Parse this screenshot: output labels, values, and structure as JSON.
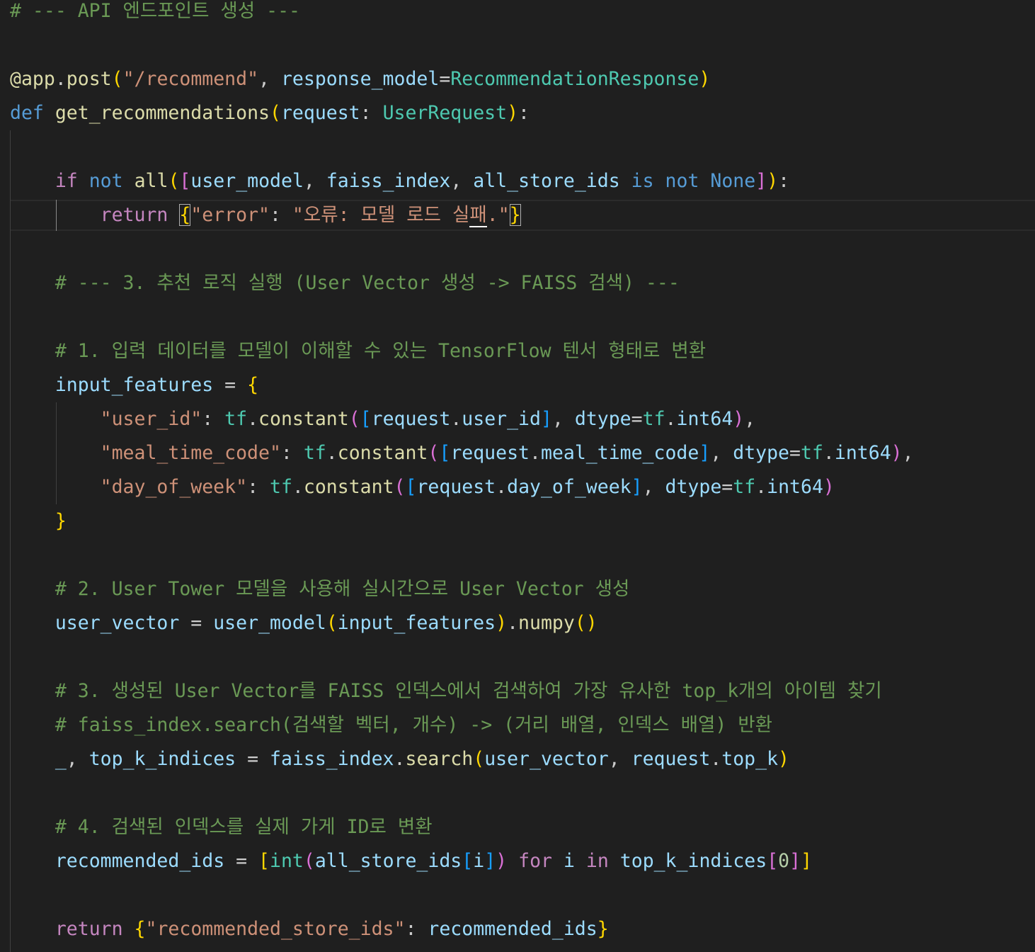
{
  "editor": {
    "language": "python",
    "colors": {
      "background": "#1f1f1f",
      "comment": "#6a9955",
      "string": "#ce9178",
      "keyword": "#569cd6",
      "control": "#c586c0",
      "function": "#dcdcaa",
      "variable": "#9cdcfe",
      "class": "#4ec9b0",
      "bracket_level_1": "#ffd700",
      "bracket_level_2": "#da70d6",
      "bracket_level_3": "#179fff"
    },
    "lines": [
      [
        [
          "# --- API 엔드포인트 생성 ---",
          "cmt"
        ]
      ],
      [],
      [
        [
          "@app",
          "fn"
        ],
        [
          ".",
          "pun"
        ],
        [
          "post",
          "fn"
        ],
        [
          "(",
          "b1"
        ],
        [
          "\"/recommend\"",
          "str"
        ],
        [
          ", ",
          "pun"
        ],
        [
          "response_model",
          "var"
        ],
        [
          "=",
          "pun"
        ],
        [
          "RecommendationResponse",
          "cls"
        ],
        [
          ")",
          "b1"
        ]
      ],
      [
        [
          "def",
          "kw"
        ],
        [
          " ",
          "pun"
        ],
        [
          "get_recommendations",
          "fn"
        ],
        [
          "(",
          "b1"
        ],
        [
          "request",
          "var"
        ],
        [
          ": ",
          "pun"
        ],
        [
          "UserRequest",
          "cls"
        ],
        [
          ")",
          "b1"
        ],
        [
          ":",
          "pun"
        ]
      ],
      [],
      [
        [
          "    ",
          "pun"
        ],
        [
          "if",
          "ctl"
        ],
        [
          " ",
          "pun"
        ],
        [
          "not",
          "kw"
        ],
        [
          " ",
          "pun"
        ],
        [
          "all",
          "fn"
        ],
        [
          "(",
          "b1"
        ],
        [
          "[",
          "b2"
        ],
        [
          "user_model",
          "var"
        ],
        [
          ", ",
          "pun"
        ],
        [
          "faiss_index",
          "var"
        ],
        [
          ", ",
          "pun"
        ],
        [
          "all_store_ids",
          "var"
        ],
        [
          " ",
          "pun"
        ],
        [
          "is",
          "kw"
        ],
        [
          " ",
          "pun"
        ],
        [
          "not",
          "kw"
        ],
        [
          " ",
          "pun"
        ],
        [
          "None",
          "kw"
        ],
        [
          "]",
          "b2"
        ],
        [
          ")",
          "b1"
        ],
        [
          ":",
          "pun"
        ]
      ],
      [
        [
          "        ",
          "pun"
        ],
        [
          "return",
          "ctl"
        ],
        [
          " ",
          "pun"
        ],
        [
          "{",
          "b1",
          "bm"
        ],
        [
          "\"error\"",
          "str"
        ],
        [
          ": ",
          "pun"
        ],
        [
          "\"오류: 모델 로드 실",
          "str"
        ],
        [
          "패",
          "str",
          "cursor"
        ],
        [
          ".\"",
          "str"
        ],
        [
          "}",
          "b1",
          "bm"
        ]
      ],
      [],
      [
        [
          "    ",
          "pun"
        ],
        [
          "# --- 3. 추천 로직 실행 (User Vector 생성 -> FAISS 검색) ---",
          "cmt"
        ]
      ],
      [],
      [
        [
          "    ",
          "pun"
        ],
        [
          "# 1. 입력 데이터를 모델이 이해할 수 있는 TensorFlow 텐서 형태로 변환",
          "cmt"
        ]
      ],
      [
        [
          "    ",
          "pun"
        ],
        [
          "input_features",
          "var"
        ],
        [
          " = ",
          "pun"
        ],
        [
          "{",
          "b1"
        ]
      ],
      [
        [
          "        ",
          "pun"
        ],
        [
          "\"user_id\"",
          "str"
        ],
        [
          ": ",
          "pun"
        ],
        [
          "tf",
          "cls"
        ],
        [
          ".",
          "pun"
        ],
        [
          "constant",
          "fn"
        ],
        [
          "(",
          "b2"
        ],
        [
          "[",
          "b3"
        ],
        [
          "request",
          "var"
        ],
        [
          ".",
          "pun"
        ],
        [
          "user_id",
          "var"
        ],
        [
          "]",
          "b3"
        ],
        [
          ", ",
          "pun"
        ],
        [
          "dtype",
          "var"
        ],
        [
          "=",
          "pun"
        ],
        [
          "tf",
          "cls"
        ],
        [
          ".",
          "pun"
        ],
        [
          "int64",
          "var"
        ],
        [
          ")",
          "b2"
        ],
        [
          ",",
          "pun"
        ]
      ],
      [
        [
          "        ",
          "pun"
        ],
        [
          "\"meal_time_code\"",
          "str"
        ],
        [
          ": ",
          "pun"
        ],
        [
          "tf",
          "cls"
        ],
        [
          ".",
          "pun"
        ],
        [
          "constant",
          "fn"
        ],
        [
          "(",
          "b2"
        ],
        [
          "[",
          "b3"
        ],
        [
          "request",
          "var"
        ],
        [
          ".",
          "pun"
        ],
        [
          "meal_time_code",
          "var"
        ],
        [
          "]",
          "b3"
        ],
        [
          ", ",
          "pun"
        ],
        [
          "dtype",
          "var"
        ],
        [
          "=",
          "pun"
        ],
        [
          "tf",
          "cls"
        ],
        [
          ".",
          "pun"
        ],
        [
          "int64",
          "var"
        ],
        [
          ")",
          "b2"
        ],
        [
          ",",
          "pun"
        ]
      ],
      [
        [
          "        ",
          "pun"
        ],
        [
          "\"day_of_week\"",
          "str"
        ],
        [
          ": ",
          "pun"
        ],
        [
          "tf",
          "cls"
        ],
        [
          ".",
          "pun"
        ],
        [
          "constant",
          "fn"
        ],
        [
          "(",
          "b2"
        ],
        [
          "[",
          "b3"
        ],
        [
          "request",
          "var"
        ],
        [
          ".",
          "pun"
        ],
        [
          "day_of_week",
          "var"
        ],
        [
          "]",
          "b3"
        ],
        [
          ", ",
          "pun"
        ],
        [
          "dtype",
          "var"
        ],
        [
          "=",
          "pun"
        ],
        [
          "tf",
          "cls"
        ],
        [
          ".",
          "pun"
        ],
        [
          "int64",
          "var"
        ],
        [
          ")",
          "b2"
        ]
      ],
      [
        [
          "    ",
          "pun"
        ],
        [
          "}",
          "b1"
        ]
      ],
      [],
      [
        [
          "    ",
          "pun"
        ],
        [
          "# 2. User Tower 모델을 사용해 실시간으로 User Vector 생성",
          "cmt"
        ]
      ],
      [
        [
          "    ",
          "pun"
        ],
        [
          "user_vector",
          "var"
        ],
        [
          " = ",
          "pun"
        ],
        [
          "user_model",
          "var"
        ],
        [
          "(",
          "b1"
        ],
        [
          "input_features",
          "var"
        ],
        [
          ")",
          "b1"
        ],
        [
          ".",
          "pun"
        ],
        [
          "numpy",
          "fn"
        ],
        [
          "()",
          "b1"
        ]
      ],
      [],
      [
        [
          "    ",
          "pun"
        ],
        [
          "# 3. 생성된 User Vector를 FAISS 인덱스에서 검색하여 가장 유사한 top_k개의 아이템 찾기",
          "cmt"
        ]
      ],
      [
        [
          "    ",
          "pun"
        ],
        [
          "# faiss_index.search(검색할 벡터, 개수) -> (거리 배열, 인덱스 배열) 반환",
          "cmt"
        ]
      ],
      [
        [
          "    ",
          "pun"
        ],
        [
          "_",
          "var"
        ],
        [
          ", ",
          "pun"
        ],
        [
          "top_k_indices",
          "var"
        ],
        [
          " = ",
          "pun"
        ],
        [
          "faiss_index",
          "var"
        ],
        [
          ".",
          "pun"
        ],
        [
          "search",
          "fn"
        ],
        [
          "(",
          "b1"
        ],
        [
          "user_vector",
          "var"
        ],
        [
          ", ",
          "pun"
        ],
        [
          "request",
          "var"
        ],
        [
          ".",
          "pun"
        ],
        [
          "top_k",
          "var"
        ],
        [
          ")",
          "b1"
        ]
      ],
      [],
      [
        [
          "    ",
          "pun"
        ],
        [
          "# 4. 검색된 인덱스를 실제 가게 ID로 변환",
          "cmt"
        ]
      ],
      [
        [
          "    ",
          "pun"
        ],
        [
          "recommended_ids",
          "var"
        ],
        [
          " = ",
          "pun"
        ],
        [
          "[",
          "b1"
        ],
        [
          "int",
          "cls"
        ],
        [
          "(",
          "b2"
        ],
        [
          "all_store_ids",
          "var"
        ],
        [
          "[",
          "b3"
        ],
        [
          "i",
          "var"
        ],
        [
          "]",
          "b3"
        ],
        [
          ")",
          "b2"
        ],
        [
          " ",
          "pun"
        ],
        [
          "for",
          "ctl"
        ],
        [
          " ",
          "pun"
        ],
        [
          "i",
          "var"
        ],
        [
          " ",
          "pun"
        ],
        [
          "in",
          "ctl"
        ],
        [
          " ",
          "pun"
        ],
        [
          "top_k_indices",
          "var"
        ],
        [
          "[",
          "b2"
        ],
        [
          "0",
          "num"
        ],
        [
          "]",
          "b2"
        ],
        [
          "]",
          "b1"
        ]
      ],
      [],
      [
        [
          "    ",
          "pun"
        ],
        [
          "return",
          "ctl"
        ],
        [
          " ",
          "pun"
        ],
        [
          "{",
          "b1"
        ],
        [
          "\"recommended_store_ids\"",
          "str"
        ],
        [
          ": ",
          "pun"
        ],
        [
          "recommended_ids",
          "var"
        ],
        [
          "}",
          "b1"
        ]
      ]
    ]
  }
}
